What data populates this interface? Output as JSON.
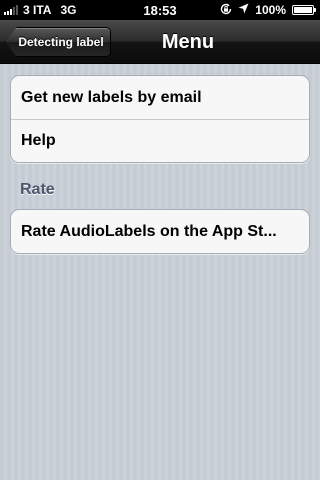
{
  "status_bar": {
    "carrier": "3 ITA",
    "network": "3G",
    "time": "18:53",
    "battery_percent": "100%",
    "battery_level": 1.0
  },
  "nav_bar": {
    "back_label": "Detecting label",
    "title": "Menu"
  },
  "groups": {
    "main": {
      "items": [
        {
          "label": "Get new labels by email"
        },
        {
          "label": "Help"
        }
      ]
    },
    "rate": {
      "header": "Rate",
      "items": [
        {
          "label": "Rate AudioLabels on the App St..."
        }
      ]
    }
  },
  "icons": {
    "signal": "signal-bars-icon",
    "orientation_lock": "orientation-lock-icon",
    "location": "location-arrow-icon",
    "battery": "battery-icon"
  },
  "colors": {
    "background": "#c5ccd4",
    "nav_bar": "#1a1a1a",
    "section_header": "#4c566c"
  }
}
